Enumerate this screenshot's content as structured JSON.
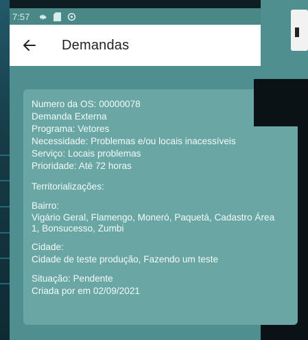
{
  "status_bar": {
    "time": "7:57"
  },
  "header": {
    "title": "Demandas"
  },
  "details": {
    "numero_os": "Numero da OS: 00000078",
    "demanda_tipo": "Demanda Externa",
    "programa": "Programa: Vetores",
    "necessidade": "Necessidade: Problemas e/ou locais inacessíveis",
    "servico": "Serviço: Locais problemas",
    "prioridade": "Prioridade: Até 72 horas",
    "territorializacoes_label": "Territorializações:",
    "bairro_label": "Bairro:",
    "bairro_value": "Vigário Geral, Flamengo, Moneró, Paquetá, Cadastro Área 1, Bonsucesso, Zumbi",
    "cidade_label": "Cidade:",
    "cidade_value": "Cidade de teste produção, Fazendo um teste",
    "situacao": "Situação: Pendente",
    "criada_por": "Criada por  em 02/09/2021"
  }
}
